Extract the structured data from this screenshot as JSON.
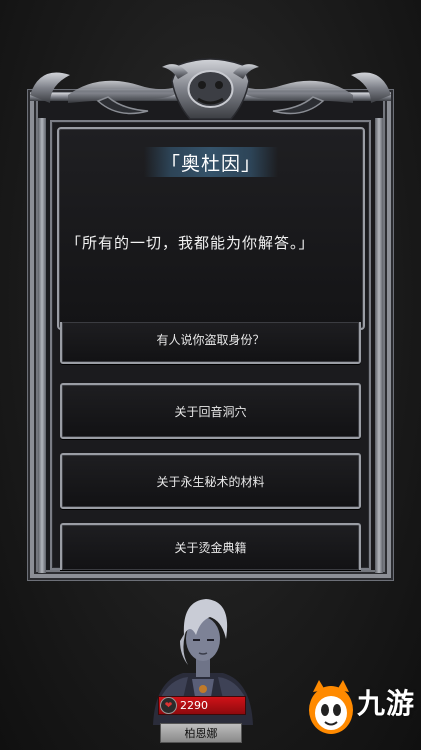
{
  "dialog": {
    "speaker": "「奥杜因」",
    "text": "「所有的一切，我都能为你解答。」"
  },
  "options": [
    {
      "label": "有人说你盗取身份？"
    },
    {
      "label": "关于回音洞穴"
    },
    {
      "label": "关于永生秘术的材料"
    },
    {
      "label": "关于烫金典籍"
    }
  ],
  "player": {
    "hp": "2290",
    "name": "柏恩娜"
  },
  "watermark": {
    "text": "九游"
  },
  "colors": {
    "frame": "#8c8f96",
    "hp_bar": "#d01218",
    "name_plate": "#35536a",
    "logo": "#ff8a00"
  }
}
